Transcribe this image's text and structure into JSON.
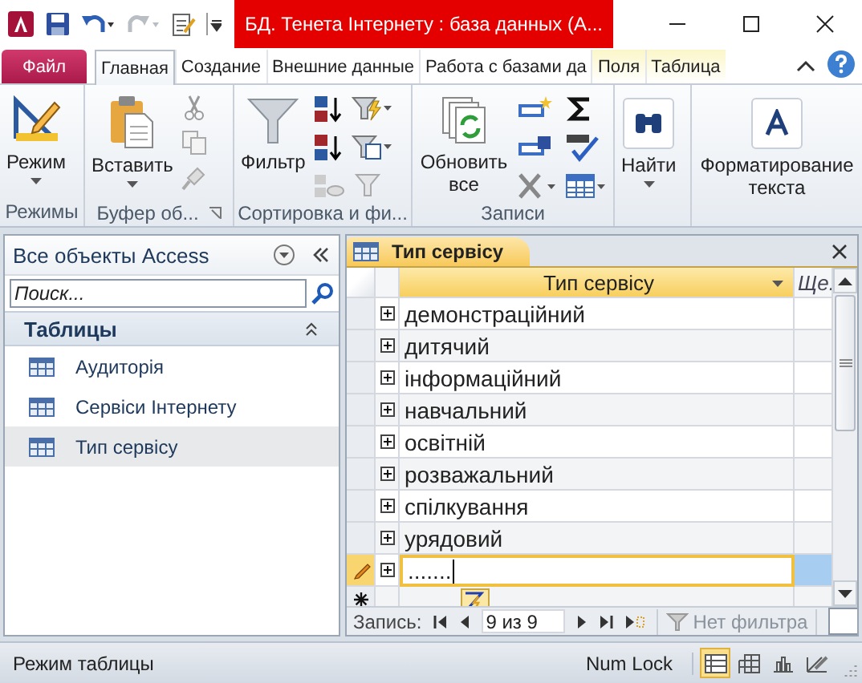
{
  "window": {
    "title": "БД. Тенета Інтернету : база данных (A..."
  },
  "ribbon_tabs": [
    {
      "label": "Файл",
      "kind": "file",
      "selected": false
    },
    {
      "label": "Главная",
      "kind": "normal",
      "selected": true
    },
    {
      "label": "Создание",
      "kind": "normal",
      "selected": false
    },
    {
      "label": "Внешние данные",
      "kind": "normal",
      "selected": false
    },
    {
      "label": "Работа с базами да",
      "kind": "normal",
      "selected": false
    },
    {
      "label": "Поля",
      "kind": "contextual",
      "selected": false
    },
    {
      "label": "Таблица",
      "kind": "contextual",
      "selected": false
    }
  ],
  "ribbon": {
    "views": {
      "button": "Режим",
      "label": "Режимы"
    },
    "clipboard": {
      "button": "Вставить",
      "label": "Буфер об..."
    },
    "sort_filter": {
      "button": "Фильтр",
      "label": "Сортировка и фи..."
    },
    "records": {
      "button": "Обновить все",
      "label": "Записи"
    },
    "find": {
      "button": "Найти"
    },
    "text_format": {
      "button": "Форматирование текста"
    }
  },
  "navigation_pane": {
    "title": "Все объекты Access",
    "search": {
      "placeholder": "Поиск..."
    },
    "section": {
      "label": "Таблицы"
    },
    "items": [
      {
        "label": "Аудиторія",
        "selected": false
      },
      {
        "label": "Сервіси Інтернету",
        "selected": false
      },
      {
        "label": "Тип сервісу",
        "selected": true
      }
    ]
  },
  "document_tab": {
    "title": "Тип сервісу"
  },
  "table": {
    "columns": [
      "Тип сервісу",
      "Ще."
    ],
    "rows": [
      {
        "kind": "record",
        "value": "демонстраційний"
      },
      {
        "kind": "record",
        "value": "дитячий"
      },
      {
        "kind": "record",
        "value": "інформаційний"
      },
      {
        "kind": "record",
        "value": "навчальний"
      },
      {
        "kind": "record",
        "value": "освітній"
      },
      {
        "kind": "record",
        "value": "розважальний"
      },
      {
        "kind": "record",
        "value": "спілкування"
      },
      {
        "kind": "record",
        "value": "урядовий"
      },
      {
        "kind": "editing",
        "value": "......."
      },
      {
        "kind": "new"
      }
    ]
  },
  "record_nav": {
    "label": "Запись:",
    "position": "9 из 9",
    "filter": "Нет фильтра"
  },
  "status_bar": {
    "mode": "Режим таблицы",
    "num_lock": "Num Lock",
    "views": [
      {
        "selected": true
      },
      {
        "selected": false
      },
      {
        "selected": false
      },
      {
        "selected": false
      }
    ]
  }
}
